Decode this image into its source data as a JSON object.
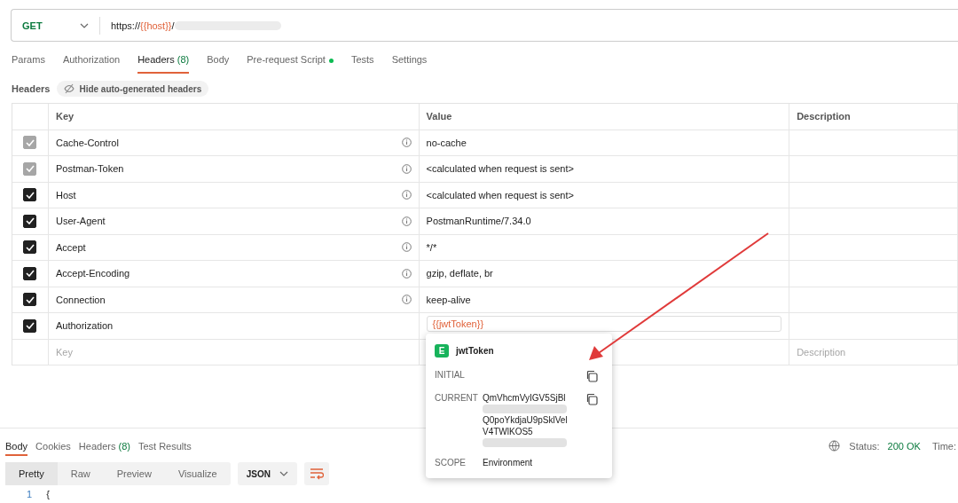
{
  "request": {
    "method": "GET",
    "url": [
      {
        "kind": "plain",
        "text": "https://"
      },
      {
        "kind": "variable",
        "text": "{{host}}"
      },
      {
        "kind": "plain",
        "text": "/"
      },
      {
        "kind": "redacted"
      }
    ]
  },
  "tabs": [
    {
      "label": "Params",
      "selected": false
    },
    {
      "label": "Authorization",
      "selected": false
    },
    {
      "label": "Headers",
      "count": "(8)",
      "selected": true
    },
    {
      "label": "Body",
      "selected": false
    },
    {
      "label": "Pre-request Script",
      "dot": true,
      "selected": false
    },
    {
      "label": "Tests",
      "selected": false
    },
    {
      "label": "Settings",
      "selected": false
    }
  ],
  "headers_bar": {
    "label": "Headers",
    "toggle": "Hide auto-generated headers"
  },
  "table": {
    "columns": [
      "Key",
      "Value",
      "Description"
    ],
    "rows": [
      {
        "key": "Cache-Control",
        "value": "no-cache",
        "checked": true,
        "disabled": true,
        "info": true
      },
      {
        "key": "Postman-Token",
        "value": "<calculated when request is sent>",
        "checked": true,
        "disabled": true,
        "info": true
      },
      {
        "key": "Host",
        "value": "<calculated when request is sent>",
        "checked": true,
        "disabled": false,
        "info": true
      },
      {
        "key": "User-Agent",
        "value": "PostmanRuntime/7.34.0",
        "checked": true,
        "disabled": false,
        "info": true
      },
      {
        "key": "Accept",
        "value": "*/*",
        "checked": true,
        "disabled": false,
        "info": true
      },
      {
        "key": "Accept-Encoding",
        "value": "gzip, deflate, br",
        "checked": true,
        "disabled": false,
        "info": true
      },
      {
        "key": "Connection",
        "value": "keep-alive",
        "checked": true,
        "disabled": false,
        "info": true
      },
      {
        "key": "Authorization",
        "value": "{{jwtToken}}",
        "checked": true,
        "disabled": false,
        "info": false,
        "editing": true
      }
    ],
    "new_row": {
      "key_placeholder": "Key",
      "description_placeholder": "Description"
    }
  },
  "popover": {
    "badge": "E",
    "name": "jwtToken",
    "initial_label": "INITIAL",
    "current_label": "CURRENT",
    "current_lines": [
      {
        "text": "QmVhcmVyIGV5SjBl",
        "redacted": false
      },
      {
        "redacted": true
      },
      {
        "text": "Q0poYkdjaU9pSklVel",
        "redacted": false
      },
      {
        "text": "V4TWlKOS5",
        "redacted": false
      },
      {
        "redacted": true
      }
    ],
    "scope_label": "SCOPE",
    "scope": "Environment"
  },
  "response": {
    "tabs": [
      {
        "label": "Body",
        "selected": true
      },
      {
        "label": "Cookies",
        "selected": false
      },
      {
        "label": "Headers",
        "count": "(8)",
        "selected": false
      },
      {
        "label": "Test Results",
        "selected": false
      }
    ],
    "status_label": "Status:",
    "status": "200 OK",
    "time_label": "Time:",
    "views": [
      {
        "label": "Pretty",
        "selected": true
      },
      {
        "label": "Raw",
        "selected": false
      },
      {
        "label": "Preview",
        "selected": false
      },
      {
        "label": "Visualize",
        "selected": false
      }
    ],
    "format": "JSON",
    "line_number": "1",
    "line_text": "{"
  }
}
